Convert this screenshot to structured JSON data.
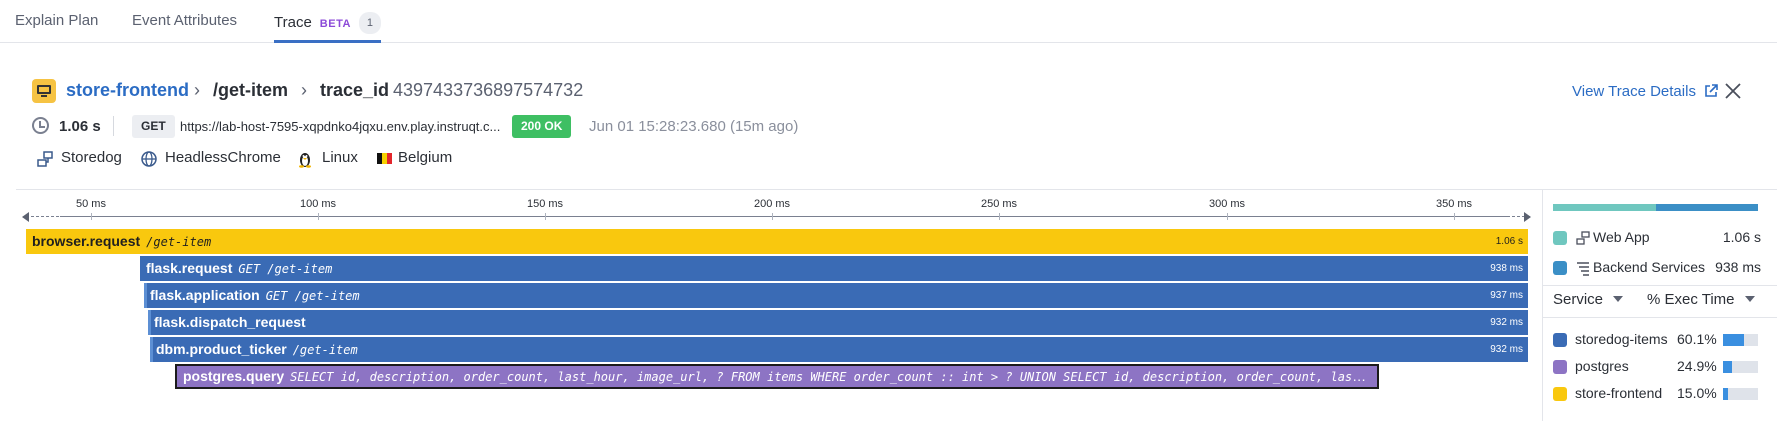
{
  "tabs": [
    {
      "label": "Explain Plan"
    },
    {
      "label": "Event Attributes"
    },
    {
      "label": "Trace",
      "badge": "BETA",
      "count": "1"
    }
  ],
  "header": {
    "service": "store-frontend",
    "resource": "/get-item",
    "trace_label": "trace_id",
    "trace_id": "4397433736897574732",
    "view_trace_details": "View Trace Details"
  },
  "meta": {
    "duration": "1.06 s",
    "method": "GET",
    "url": "https://lab-host-7595-xqpdnko4jqxu.env.play.instruqt.c...",
    "status": "200 OK",
    "timestamp": "Jun 01 15:28:23.680 (15m ago)"
  },
  "tags": [
    {
      "label": "Storedog",
      "icon": "service-icon"
    },
    {
      "label": "HeadlessChrome",
      "icon": "globe-icon"
    },
    {
      "label": "Linux",
      "icon": "linux-icon"
    },
    {
      "label": "Belgium",
      "icon": "belgium-flag-icon"
    }
  ],
  "timeline": {
    "ticks": [
      "50 ms",
      "100 ms",
      "150 ms",
      "200 ms",
      "250 ms",
      "300 ms",
      "350 ms"
    ]
  },
  "spans": [
    {
      "operation": "browser.request",
      "resource": "/get-item",
      "duration": "1.06 s",
      "service": "store-frontend"
    },
    {
      "operation": "flask.request",
      "resource": "GET /get-item",
      "duration": "938 ms",
      "service": "storedog-items"
    },
    {
      "operation": "flask.application",
      "resource": "GET /get-item",
      "duration": "937 ms",
      "service": "storedog-items"
    },
    {
      "operation": "flask.dispatch_request",
      "resource": "",
      "duration": "932 ms",
      "service": "storedog-items"
    },
    {
      "operation": "dbm.product_ticker",
      "resource": "/get-item",
      "duration": "932 ms",
      "service": "storedog-items"
    },
    {
      "operation": "postgres.query",
      "resource": "SELECT id, description, order_count, last_hour, image_url, ? FROM items WHERE order_count :: int > ? UNION SELECT id, description, order_count, last_ho…",
      "duration": "",
      "service": "postgres"
    }
  ],
  "side_panel": {
    "exec_split": [
      {
        "name": "Web App",
        "value": "1.06 s",
        "color": "#6fc7bf"
      },
      {
        "name": "Backend Services",
        "value": "938 ms",
        "color": "#3b8fc6"
      }
    ],
    "sort_service": "Service",
    "sort_exec": "% Exec Time",
    "services": [
      {
        "name": "storedog-items",
        "pct": "60.1%",
        "fraction": 0.601,
        "color": "#3a6bb5"
      },
      {
        "name": "postgres",
        "pct": "24.9%",
        "fraction": 0.249,
        "color": "#8d74c4"
      },
      {
        "name": "store-frontend",
        "pct": "15.0%",
        "fraction": 0.15,
        "color": "#f9c80e"
      }
    ]
  }
}
